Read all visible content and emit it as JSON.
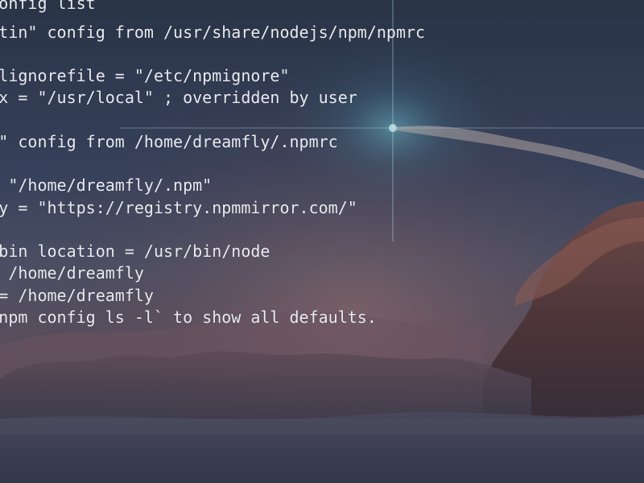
{
  "terminal": {
    "lines": [
      "$ npm config list",
      "; \"builtin\" config from /usr/share/nodejs/npm/npmrc",
      "",
      "; globalignorefile = \"/etc/npmignore\"",
      "; prefix = \"/usr/local\" ; overridden by user",
      "",
      "; \"user\" config from /home/dreamfly/.npmrc",
      "",
      "cache = \"/home/dreamfly/.npm\"",
      "registry = \"https://registry.npmmirror.com/\"",
      "",
      "; node bin location = /usr/bin/node",
      "; cwd = /home/dreamfly",
      "; HOME = /home/dreamfly",
      "; Run `npm config ls -l` to show all defaults."
    ]
  },
  "colors": {
    "terminal_text": "#e9ebf0",
    "sky_top": "#2d3a4d",
    "sky_mid": "#4a5166",
    "horizon_glow": "#7a5a5c",
    "cloud_dark": "#3c2e34",
    "star_glow": "#5fc6d8"
  },
  "icons": {
    "wallpaper": "sky-clouds-wallpaper"
  }
}
